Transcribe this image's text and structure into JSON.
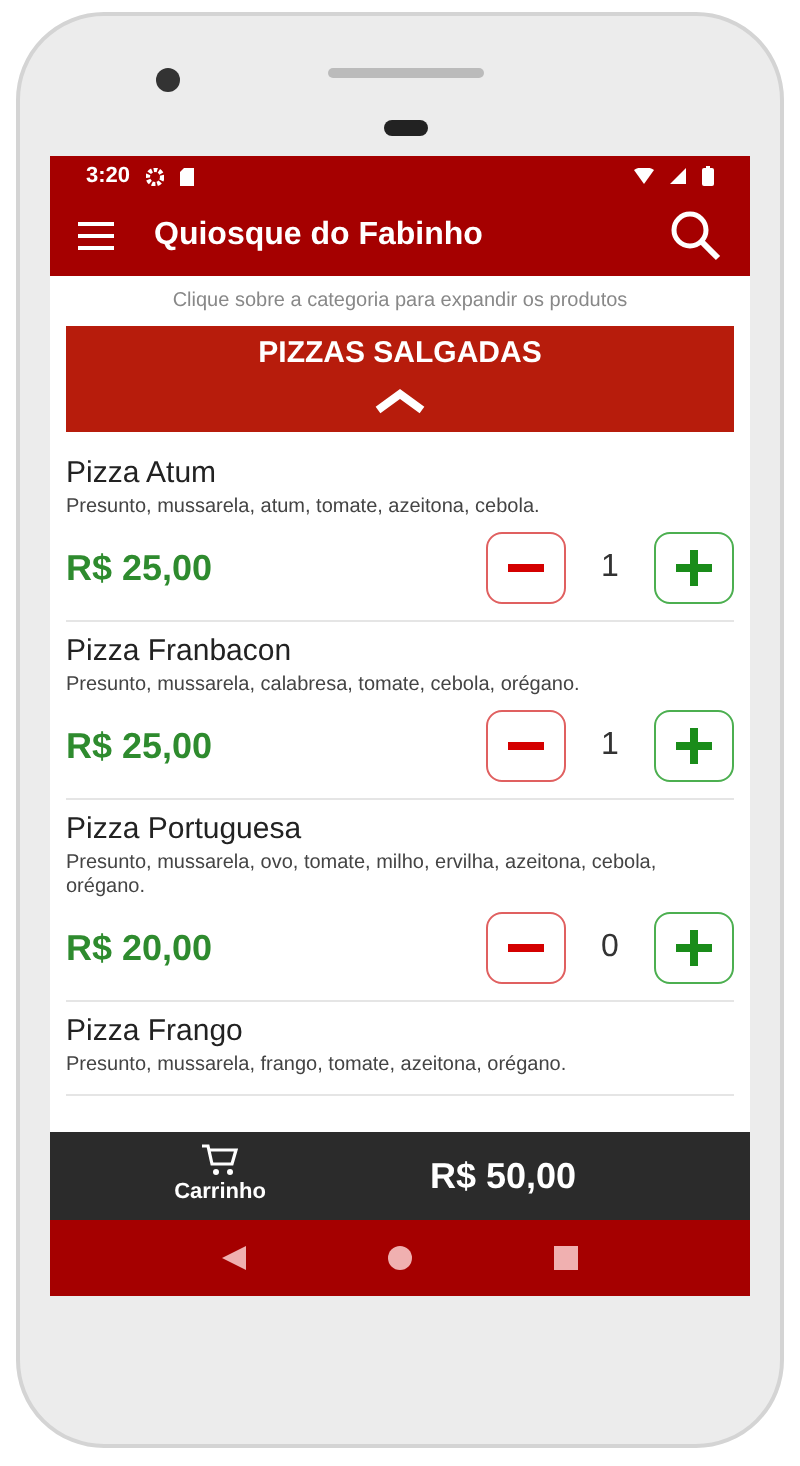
{
  "status_bar": {
    "time": "3:20"
  },
  "app_bar": {
    "title": "Quiosque do Fabinho"
  },
  "hint": "Clique sobre a categoria para expandir os produtos",
  "category": {
    "title": "PIZZAS SALGADAS",
    "expanded": true
  },
  "products": [
    {
      "name": "Pizza Atum",
      "description": "Presunto, mussarela, atum, tomate, azeitona, cebola.",
      "price": "R$ 25,00",
      "quantity": "1"
    },
    {
      "name": "Pizza Franbacon",
      "description": "Presunto, mussarela, calabresa, tomate, cebola, orégano.",
      "price": "R$ 25,00",
      "quantity": "1"
    },
    {
      "name": "Pizza Portuguesa",
      "description": "Presunto, mussarela, ovo, tomate, milho, ervilha, azeitona, cebola, orégano.",
      "price": "R$ 20,00",
      "quantity": "0"
    },
    {
      "name": "Pizza Frango",
      "description": "Presunto, mussarela, frango, tomate, azeitona, orégano."
    }
  ],
  "cart_bar": {
    "label": "Carrinho",
    "total": "R$ 50,00"
  }
}
